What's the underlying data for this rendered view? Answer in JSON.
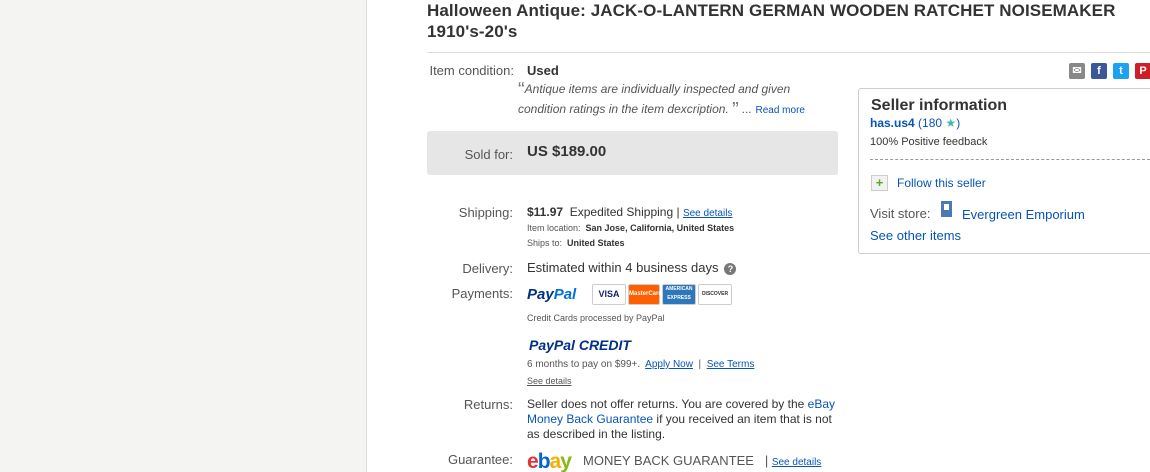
{
  "title": "Halloween Antique: JACK-O-LANTERN GERMAN WOODEN RATCHET NOISEMAKER 1910's-20's",
  "condition": {
    "label": "Item condition:",
    "value": "Used",
    "note": "Antique items are individually inspected and given condition ratings in the item dexcription.",
    "ellipsis": "...",
    "read_more": "Read more"
  },
  "sold": {
    "label": "Sold for:",
    "value": "US $189.00"
  },
  "shipping": {
    "label": "Shipping:",
    "price": "$11.97",
    "method": "Expedited Shipping",
    "sep": "|",
    "see_details": "See details",
    "location_label": "Item location:",
    "location": "San Jose, California, United States",
    "ships_to_label": "Ships to:",
    "ships_to": "United States"
  },
  "delivery": {
    "label": "Delivery:",
    "value": "Estimated within 4 business days",
    "help": "?"
  },
  "payments": {
    "label": "Payments:",
    "paypal_a": "Pay",
    "paypal_b": "Pal",
    "cards": [
      "VISA",
      "MasterCard",
      "AMERICAN EXPRESS",
      "DISCOVER"
    ],
    "cards_note": "Credit Cards processed by PayPal",
    "credit_a": "PayPal",
    "credit_b": "CREDIT",
    "credit_note": "6 months to pay on $99+.",
    "apply_now": "Apply Now",
    "sep": "|",
    "see_terms": "See Terms",
    "see_details": "See details"
  },
  "returns": {
    "label": "Returns:",
    "text_a": "Seller does not offer returns. You are covered by the",
    "link": "eBay Money Back Guarantee",
    "text_b": "if you received an item that is not as described in the listing."
  },
  "guarantee": {
    "label": "Guarantee:",
    "logo": [
      "e",
      "b",
      "a",
      "y"
    ],
    "text": "MONEY BACK GUARANTEE",
    "sep": "|",
    "see_details": "See details"
  },
  "share": {
    "email": "✉",
    "facebook": "f",
    "twitter": "t",
    "pinterest": "P"
  },
  "seller": {
    "heading": "Seller information",
    "name": "has.us4",
    "feedback_count": "(180",
    "feedback_close": ")",
    "positive": "100% Positive feedback",
    "follow": "Follow this seller",
    "visit_label": "Visit store:",
    "store": "Evergreen Emporium",
    "other_items": "See other items"
  },
  "colors": {
    "link": "#0654ba",
    "sold_bg": "#e6e6e6",
    "pumpkin": "#f2c33a"
  }
}
